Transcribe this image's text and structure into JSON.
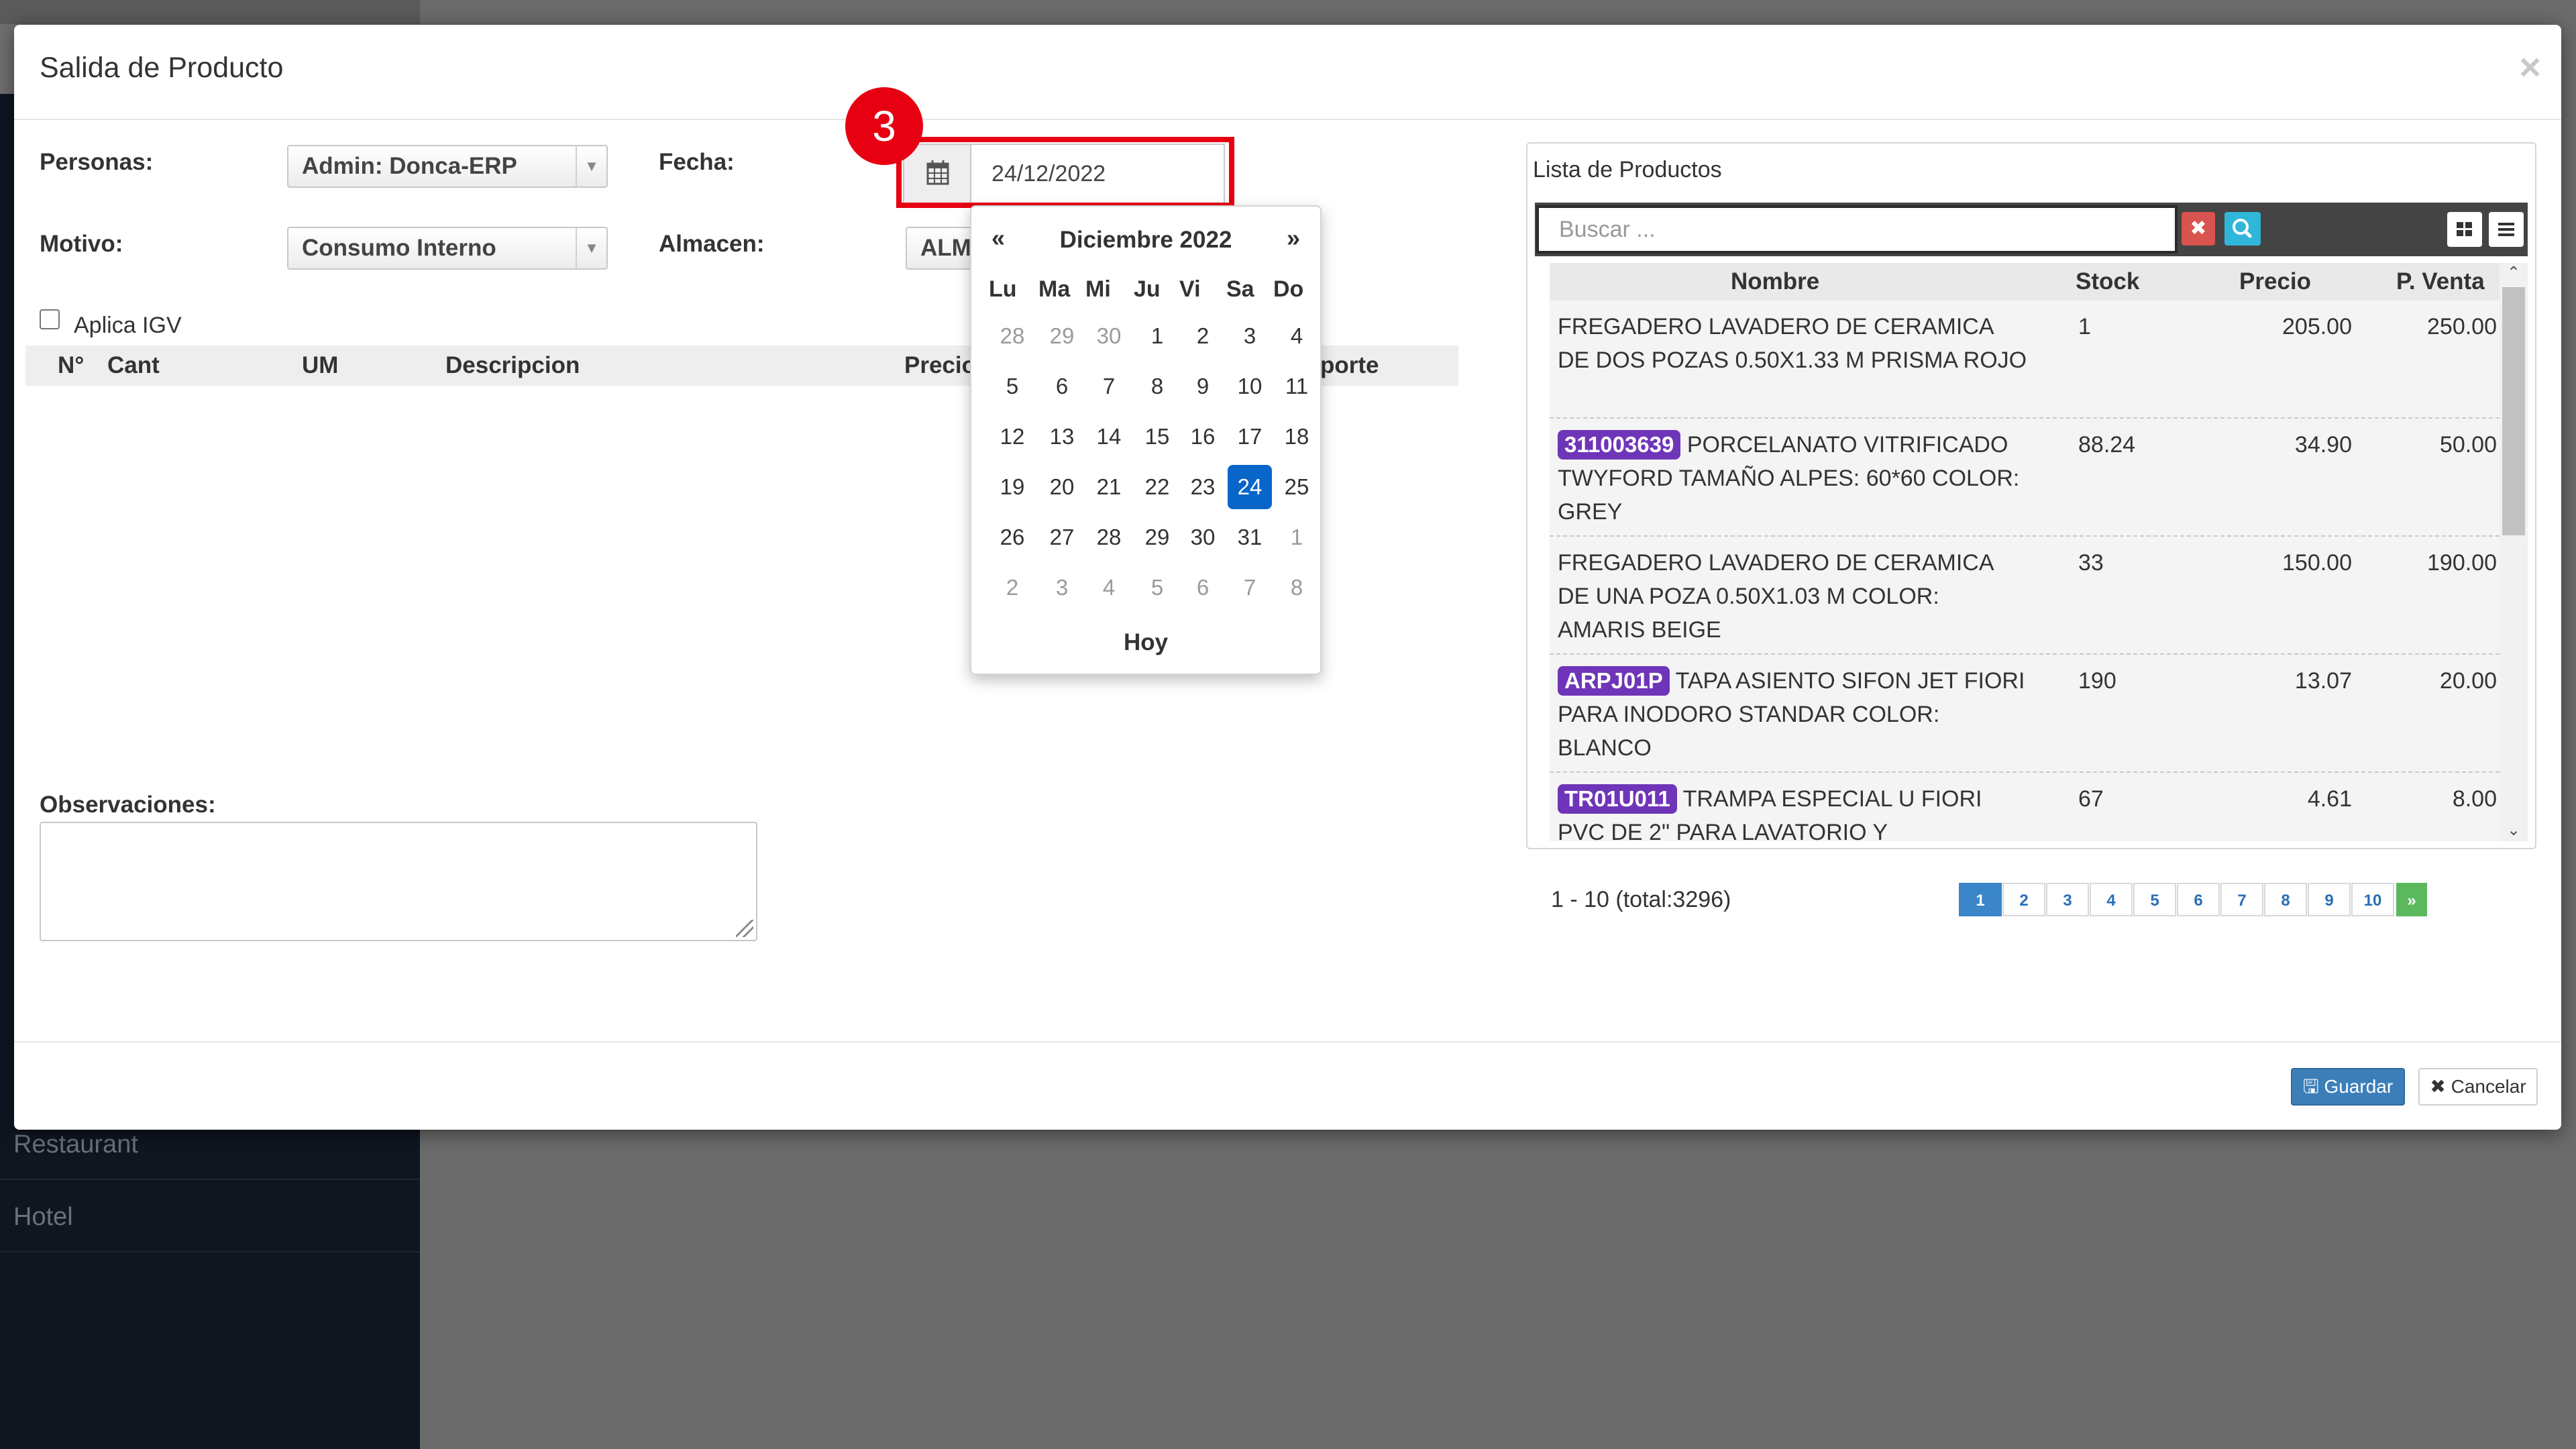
{
  "background": {
    "sidebar_items": [
      "Restaurant",
      "Hotel"
    ]
  },
  "modal": {
    "title": "Salida de Producto",
    "close_glyph": "×",
    "form": {
      "personas_label": "Personas:",
      "personas_value": "Admin: Donca-ERP",
      "motivo_label": "Motivo:",
      "motivo_value": "Consumo Interno",
      "fecha_label": "Fecha:",
      "fecha_value": "24/12/2022",
      "almacen_label": "Almacen:",
      "almacen_value": "ALM",
      "igv_label": "Aplica IGV",
      "igv_checked": false,
      "observaciones_label": "Observaciones:"
    },
    "items_table": {
      "headers": [
        "N°",
        "Cant",
        "UM",
        "Descripcion",
        "Precio",
        "porte"
      ]
    },
    "step_badge": "3",
    "datepicker": {
      "prev": "«",
      "next": "»",
      "month_title": "Diciembre 2022",
      "weekdays": [
        "Lu",
        "Ma",
        "Mi",
        "Ju",
        "Vi",
        "Sa",
        "Do"
      ],
      "weeks": [
        [
          "28",
          "29",
          "30",
          "1",
          "2",
          "3",
          "4"
        ],
        [
          "5",
          "6",
          "7",
          "8",
          "9",
          "10",
          "11"
        ],
        [
          "12",
          "13",
          "14",
          "15",
          "16",
          "17",
          "18"
        ],
        [
          "19",
          "20",
          "21",
          "22",
          "23",
          "24",
          "25"
        ],
        [
          "26",
          "27",
          "28",
          "29",
          "30",
          "31",
          "1"
        ],
        [
          "2",
          "3",
          "4",
          "5",
          "6",
          "7",
          "8"
        ]
      ],
      "selected": "24",
      "today_label": "Hoy"
    },
    "product_list": {
      "title": "Lista de Productos",
      "search_placeholder": "Buscar ...",
      "headers": {
        "name": "Nombre",
        "stock": "Stock",
        "price": "Precio",
        "sale": "P. Venta"
      },
      "rows": [
        {
          "code": "",
          "name": "FREGADERO LAVADERO DE CERAMICA DE DOS POZAS 0.50X1.33 M PRISMA ROJO",
          "stock": "1",
          "price": "205.00",
          "sale": "250.00"
        },
        {
          "code": "311003639",
          "name": "PORCELANATO VITRIFICADO TWYFORD TAMAÑO ALPES: 60*60 COLOR: GREY",
          "stock": "88.24",
          "price": "34.90",
          "sale": "50.00"
        },
        {
          "code": "",
          "name": "FREGADERO LAVADERO DE CERAMICA DE UNA POZA 0.50X1.03 M COLOR: AMARIS BEIGE",
          "stock": "33",
          "price": "150.00",
          "sale": "190.00"
        },
        {
          "code": "ARPJ01P",
          "name": "TAPA ASIENTO SIFON JET FIORI PARA INODORO STANDAR COLOR: BLANCO",
          "stock": "190",
          "price": "13.07",
          "sale": "20.00"
        },
        {
          "code": "TR01U011",
          "name": "TRAMPA ESPECIAL U FIORI PVC DE 2\" PARA LAVATORIO Y",
          "stock": "67",
          "price": "4.61",
          "sale": "8.00"
        }
      ],
      "count_text": "1 - 10 (total:3296)",
      "pages": [
        "1",
        "2",
        "3",
        "4",
        "5",
        "6",
        "7",
        "8",
        "9",
        "10"
      ],
      "next_page": "»"
    },
    "footer": {
      "save_label": "Guardar",
      "cancel_label": "Cancelar"
    }
  }
}
